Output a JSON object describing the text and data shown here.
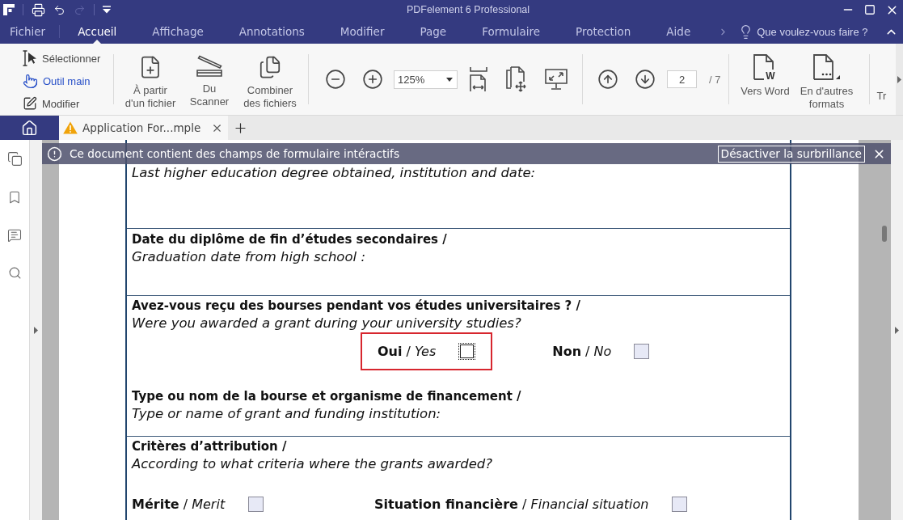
{
  "window": {
    "title": "PDFelement 6 Professional"
  },
  "menu": {
    "tabs": [
      {
        "label": "Fichier",
        "selected": false
      },
      {
        "label": "Accueil",
        "selected": true
      },
      {
        "label": "Affichage",
        "selected": false
      },
      {
        "label": "Annotations",
        "selected": false
      },
      {
        "label": "Modifier",
        "selected": false
      },
      {
        "label": "Page",
        "selected": false
      },
      {
        "label": "Formulaire",
        "selected": false
      },
      {
        "label": "Protection",
        "selected": false
      },
      {
        "label": "Aide",
        "selected": false
      }
    ],
    "tell_me": "Que voulez-vous faire ?"
  },
  "ribbon": {
    "tools": [
      {
        "kind": "select",
        "label": "Sélectionner",
        "selected": false
      },
      {
        "kind": "hand",
        "label": "Outil main",
        "selected": true
      },
      {
        "kind": "edit",
        "label": "Modifier",
        "selected": false
      }
    ],
    "create": [
      {
        "kind": "from-file",
        "label": "À partir d'un fichier"
      },
      {
        "kind": "scanner",
        "label": "Du Scanner"
      },
      {
        "kind": "combine",
        "label": "Combiner des fichiers"
      }
    ],
    "zoom": "125%",
    "page_current": "2",
    "page_total": "/ 7",
    "convert": [
      {
        "kind": "word",
        "label": "Vers Word",
        "badge": "W"
      },
      {
        "kind": "formats",
        "label": "En d'autres formats"
      },
      {
        "kind": "cut",
        "label": "Tr"
      }
    ]
  },
  "document_tabs": [
    {
      "label": "Application For...mple",
      "selected": true,
      "warning": true
    }
  ],
  "notification": {
    "message": "Ce document contient des champs de formulaire intéractifs",
    "button": "Désactiver la surbrillance"
  },
  "form": {
    "sections": [
      {
        "items": [
          {
            "kind": "translation",
            "text": "Last higher education degree obtained, institution and date:"
          }
        ]
      },
      {
        "items": [
          {
            "kind": "question",
            "text": "Date du diplôme de fin d’études secondaires /"
          },
          {
            "kind": "translation",
            "text": "Graduation date from high school :"
          }
        ]
      },
      {
        "items": [
          {
            "kind": "question",
            "text": "Avez-vous reçu des bourses pendant vos études universitaires ? /"
          },
          {
            "kind": "translation",
            "text": "Were you awarded a grant during your university studies?"
          },
          {
            "kind": "choices",
            "options": [
              {
                "label": "**Oui** / *Yes*",
                "checked": false,
                "focused": true,
                "highlighted": true
              },
              {
                "label": "**Non** / *No*",
                "checked": false,
                "focused": false,
                "highlighted": false
              }
            ]
          },
          {
            "kind": "question",
            "text": "Type ou nom de la bourse et organisme de financement /"
          },
          {
            "kind": "translation",
            "text": "Type or name of grant and funding institution:"
          }
        ]
      },
      {
        "items": [
          {
            "kind": "question",
            "text": "Critères d’attribution /"
          },
          {
            "kind": "translation",
            "text": "According to what criteria where the grants awarded?"
          },
          {
            "kind": "choice-columns",
            "options": [
              {
                "label": "**Mérite** / *Merit*",
                "checked": false,
                "focused": false
              },
              {
                "label": "**Situation financière** / *Financial situation*",
                "checked": false,
                "focused": false
              }
            ]
          }
        ]
      }
    ]
  }
}
